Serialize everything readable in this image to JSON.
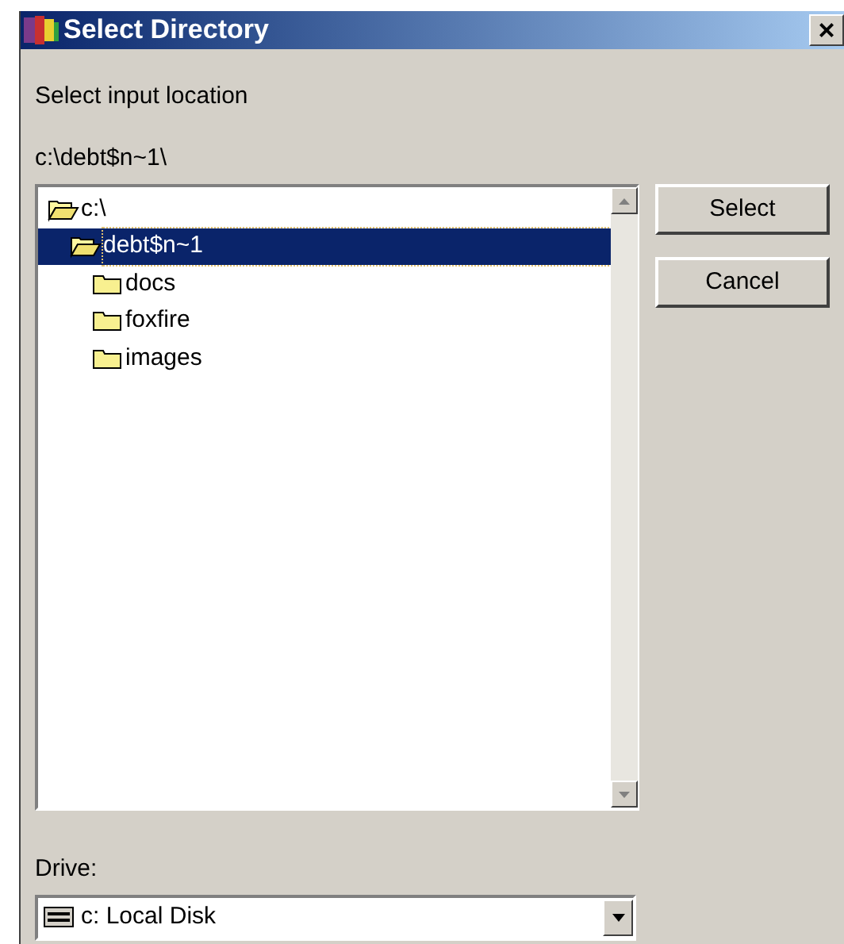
{
  "window": {
    "title": "Select Directory",
    "close": "×"
  },
  "prompt": "Select input location",
  "current_path": "c:\\debt$n~1\\",
  "tree": [
    {
      "label": "c:\\",
      "expanded": true,
      "selected": false,
      "children": [
        {
          "label": "debt$n~1",
          "expanded": true,
          "selected": true,
          "children": [
            {
              "label": "docs",
              "expanded": false,
              "selected": false
            },
            {
              "label": "foxfire",
              "expanded": false,
              "selected": false
            },
            {
              "label": "images",
              "expanded": false,
              "selected": false
            }
          ]
        }
      ]
    }
  ],
  "buttons": [
    "Select",
    "Cancel"
  ],
  "drive": {
    "label": "Drive:",
    "value": "c: Local Disk"
  }
}
